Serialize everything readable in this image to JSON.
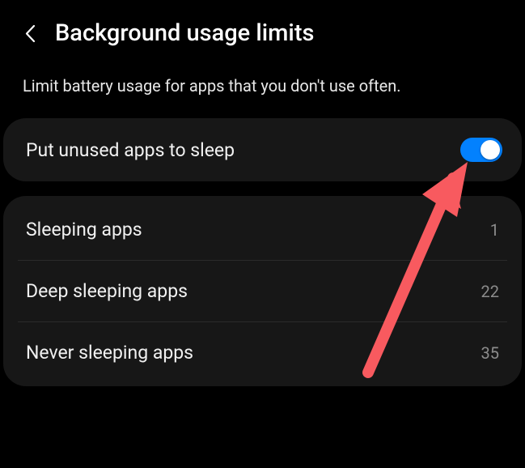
{
  "header": {
    "title": "Background usage limits"
  },
  "description": "Limit battery usage for apps that you don't use often.",
  "toggle": {
    "label": "Put unused apps to sleep",
    "on": true
  },
  "items": [
    {
      "label": "Sleeping apps",
      "count": "1"
    },
    {
      "label": "Deep sleeping apps",
      "count": "22"
    },
    {
      "label": "Never sleeping apps",
      "count": "35"
    }
  ],
  "annotation": {
    "arrow_color": "#f85a5f"
  }
}
